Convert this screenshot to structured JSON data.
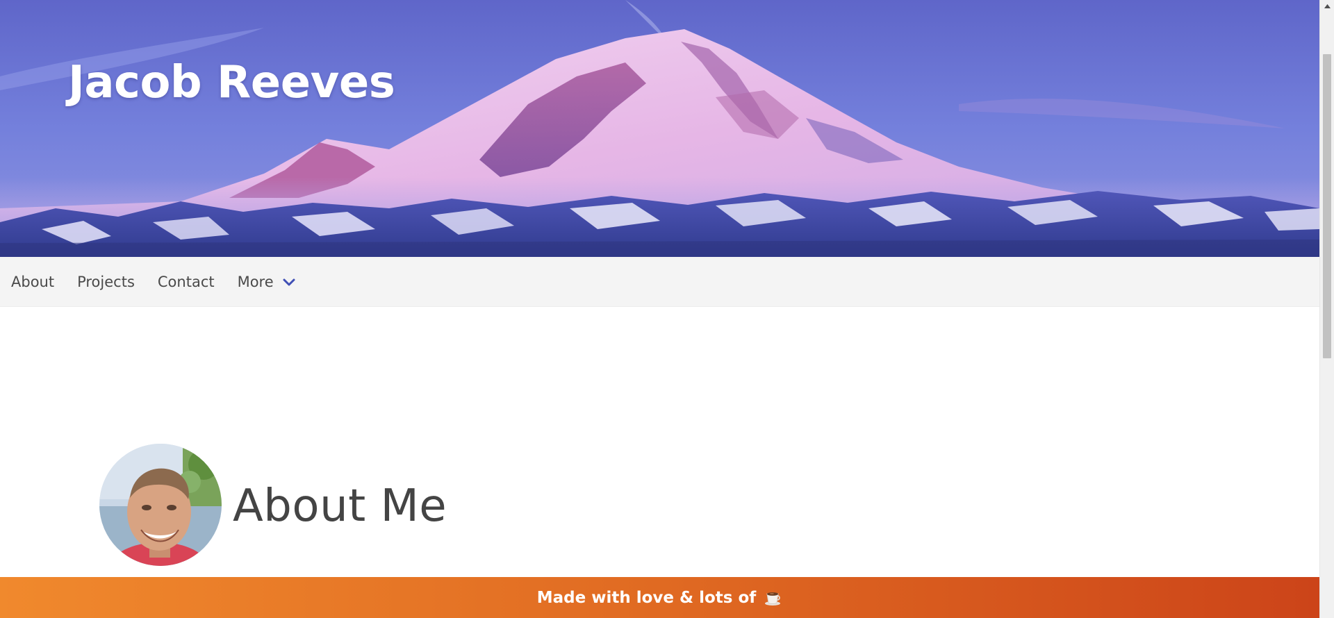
{
  "header": {
    "site_title": "Jacob Reeves"
  },
  "nav": {
    "items": [
      {
        "label": "About"
      },
      {
        "label": "Projects"
      },
      {
        "label": "Contact"
      },
      {
        "label": "More",
        "icon": "chevron-down-icon"
      }
    ]
  },
  "about": {
    "heading": "About Me",
    "avatar_icon": "profile-photo"
  },
  "footer": {
    "text": "Made with love & lots of",
    "icon": "coffee-icon"
  },
  "colors": {
    "nav_bg": "#f4f4f4",
    "nav_text": "#4a4a4a",
    "chevron": "#3f4fb5",
    "footer_gradient_start": "#f0892d",
    "footer_gradient_end": "#cc4419",
    "heading_text": "#444444"
  }
}
